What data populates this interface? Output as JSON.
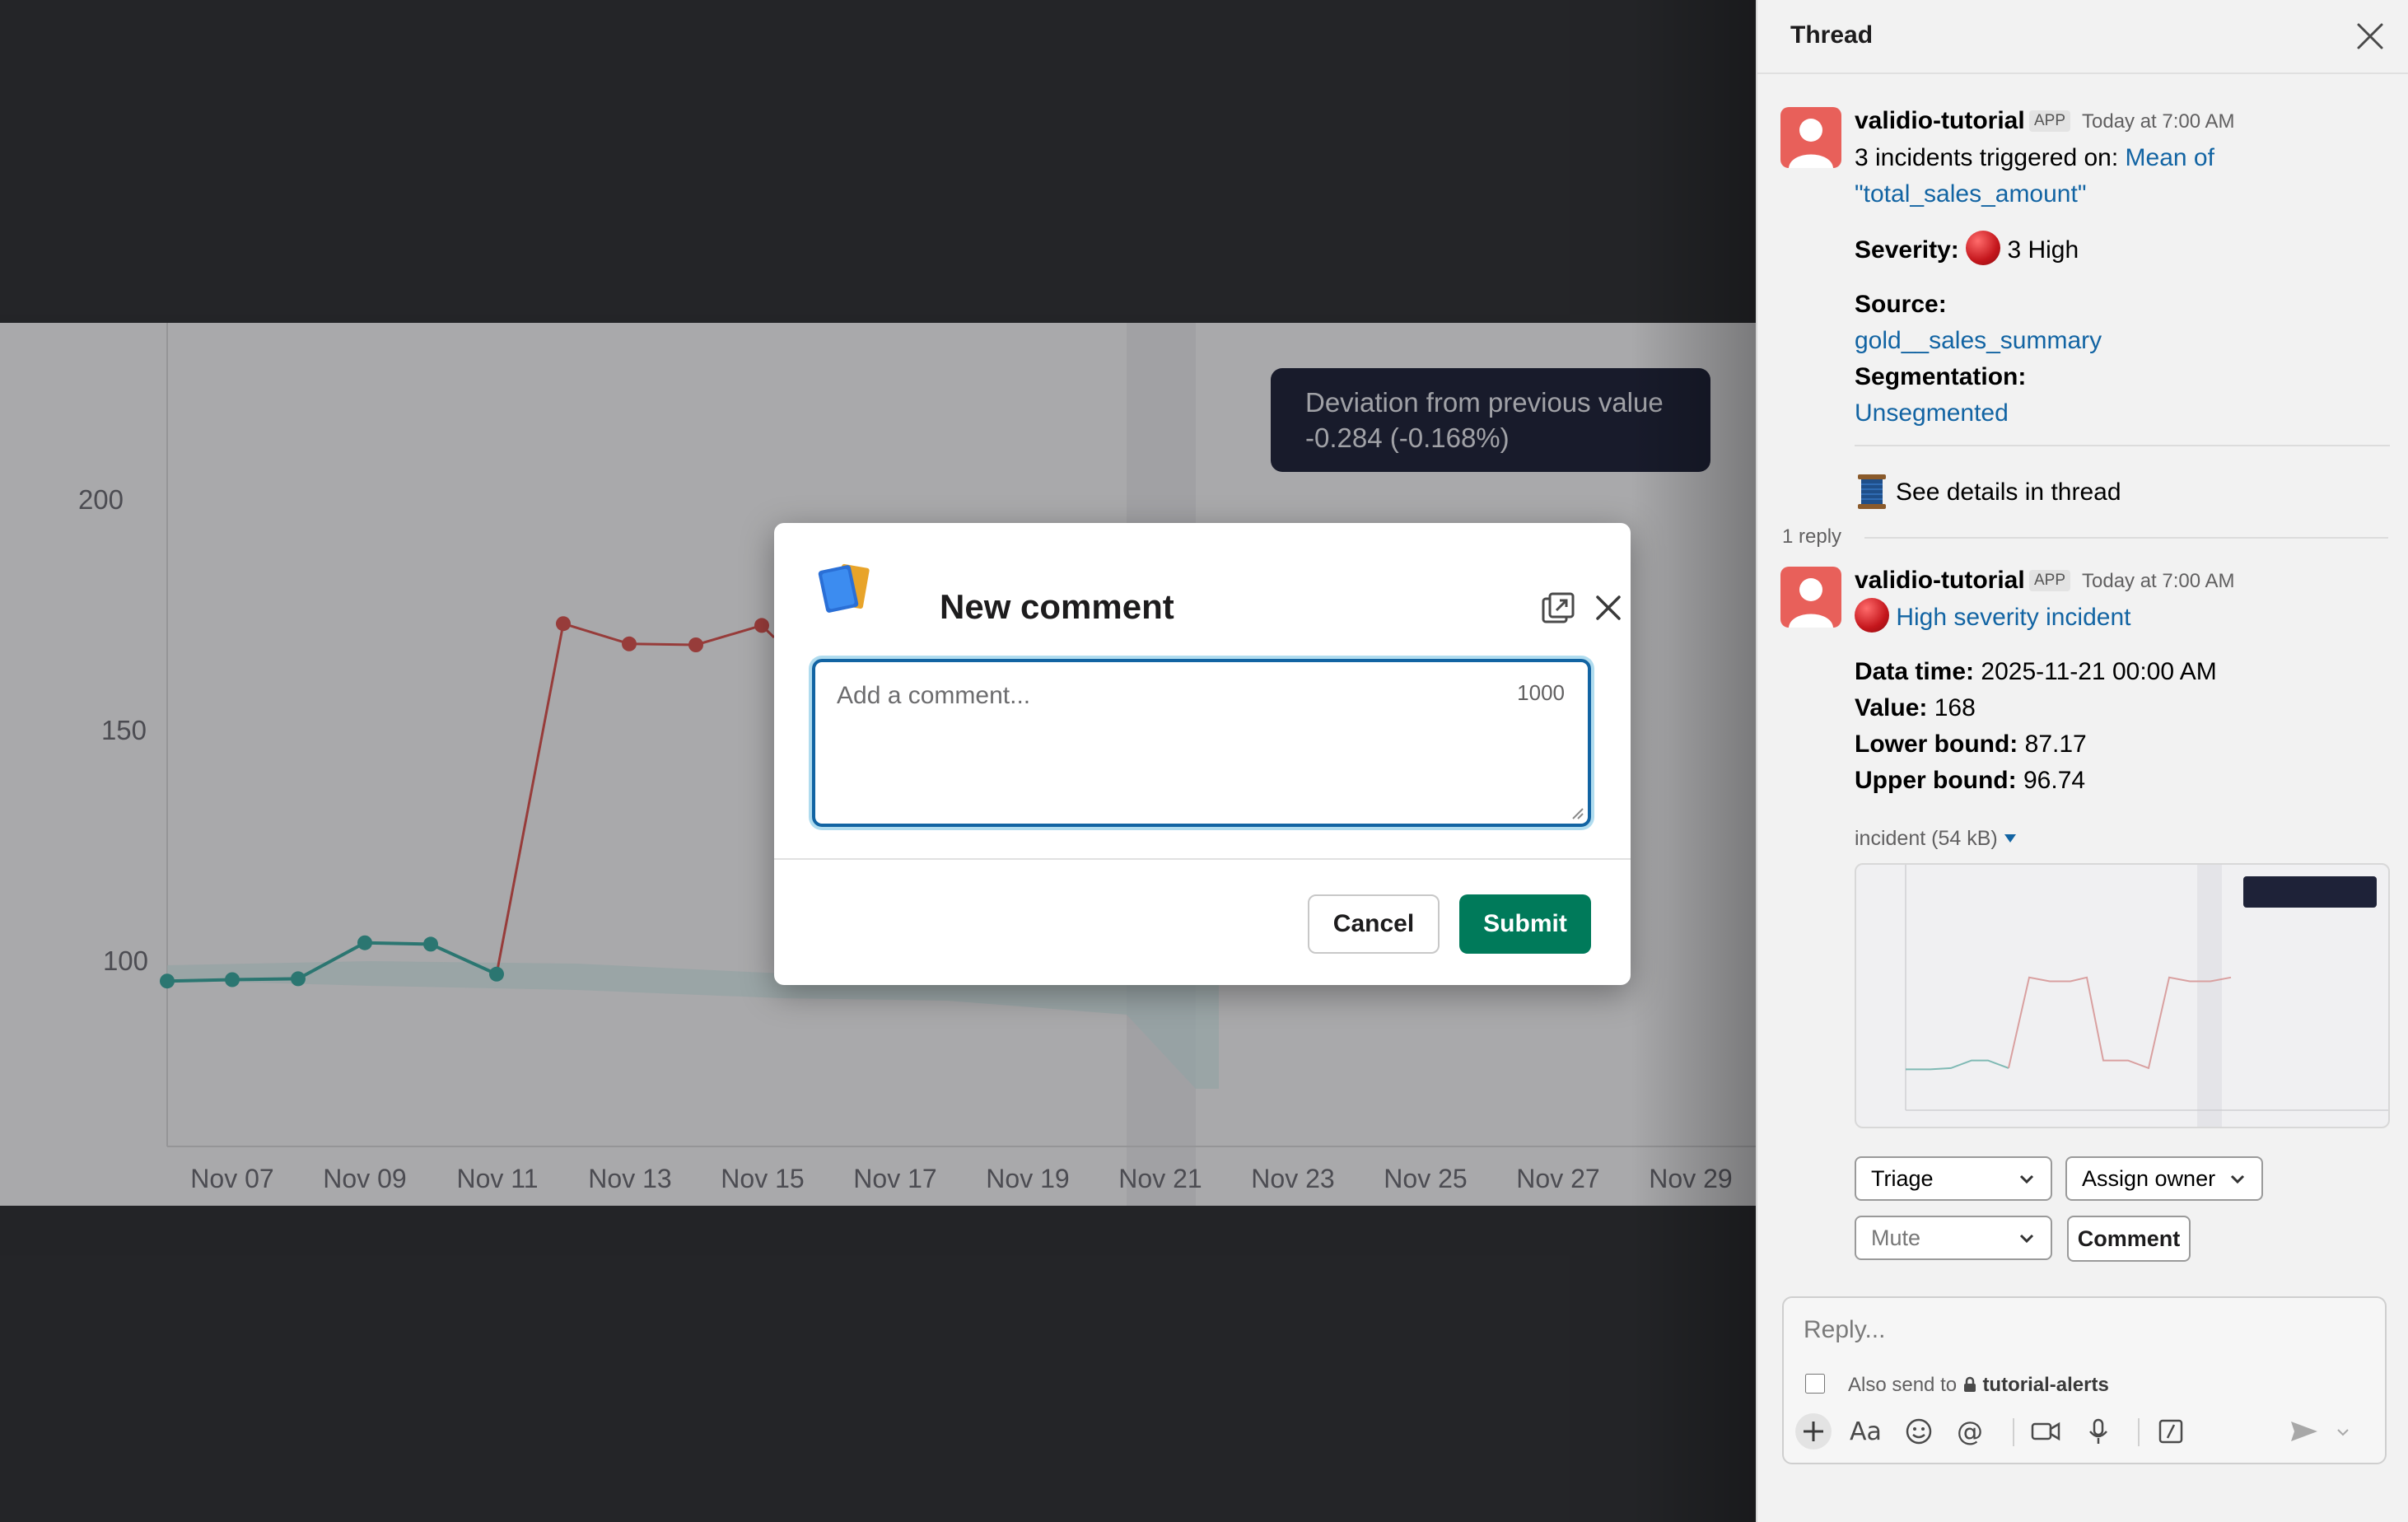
{
  "chart": {
    "y_ticks": [
      "200",
      "150",
      "100"
    ],
    "x_ticks": [
      "Nov 07",
      "Nov 09",
      "Nov 11",
      "Nov 13",
      "Nov 15",
      "Nov 17",
      "Nov 19",
      "Nov 21",
      "Nov 23",
      "Nov 25",
      "Nov 27",
      "Nov 29"
    ],
    "series_normal_color": "#3aa99f",
    "series_anomaly_color": "#d9534f",
    "tooltip": {
      "line1": "Deviation from previous value",
      "line2": "-0.284  (-0.168%)"
    }
  },
  "modal": {
    "title": "New comment",
    "placeholder": "Add a comment...",
    "char_limit": "1000",
    "cancel_label": "Cancel",
    "submit_label": "Submit"
  },
  "thread": {
    "title": "Thread",
    "message1": {
      "sender": "validio-tutorial",
      "badge": "APP",
      "time": "Today at 7:00 AM",
      "intro": "3 incidents triggered on: ",
      "metric_link_1": "Mean of",
      "metric_link_2": "\"total_sales_amount\"",
      "severity_label": "Severity:",
      "severity_value": "3 High",
      "source_label": "Source:",
      "source_value": "gold__sales_summary",
      "segmentation_label": "Segmentation:",
      "segmentation_value": "Unsegmented",
      "details_text": "See details in thread"
    },
    "reply_count": "1 reply",
    "message2": {
      "sender": "validio-tutorial",
      "badge": "APP",
      "time": "Today at 7:00 AM",
      "incident_link": "High severity incident",
      "data_time_label": "Data time:",
      "data_time_value": "2025-11-21 00:00 AM",
      "value_label": "Value:",
      "value_value": "168",
      "lower_label": "Lower bound:",
      "lower_value": "87.17",
      "upper_label": "Upper bound:",
      "upper_value": "96.74",
      "attachment_label": "incident (54 kB)"
    },
    "actions": {
      "triage": "Triage",
      "assign_owner": "Assign owner",
      "mute": "Mute",
      "comment": "Comment"
    },
    "composer": {
      "placeholder": "Reply...",
      "also_send_prefix": "Also send to",
      "channel": "tutorial-alerts"
    }
  }
}
